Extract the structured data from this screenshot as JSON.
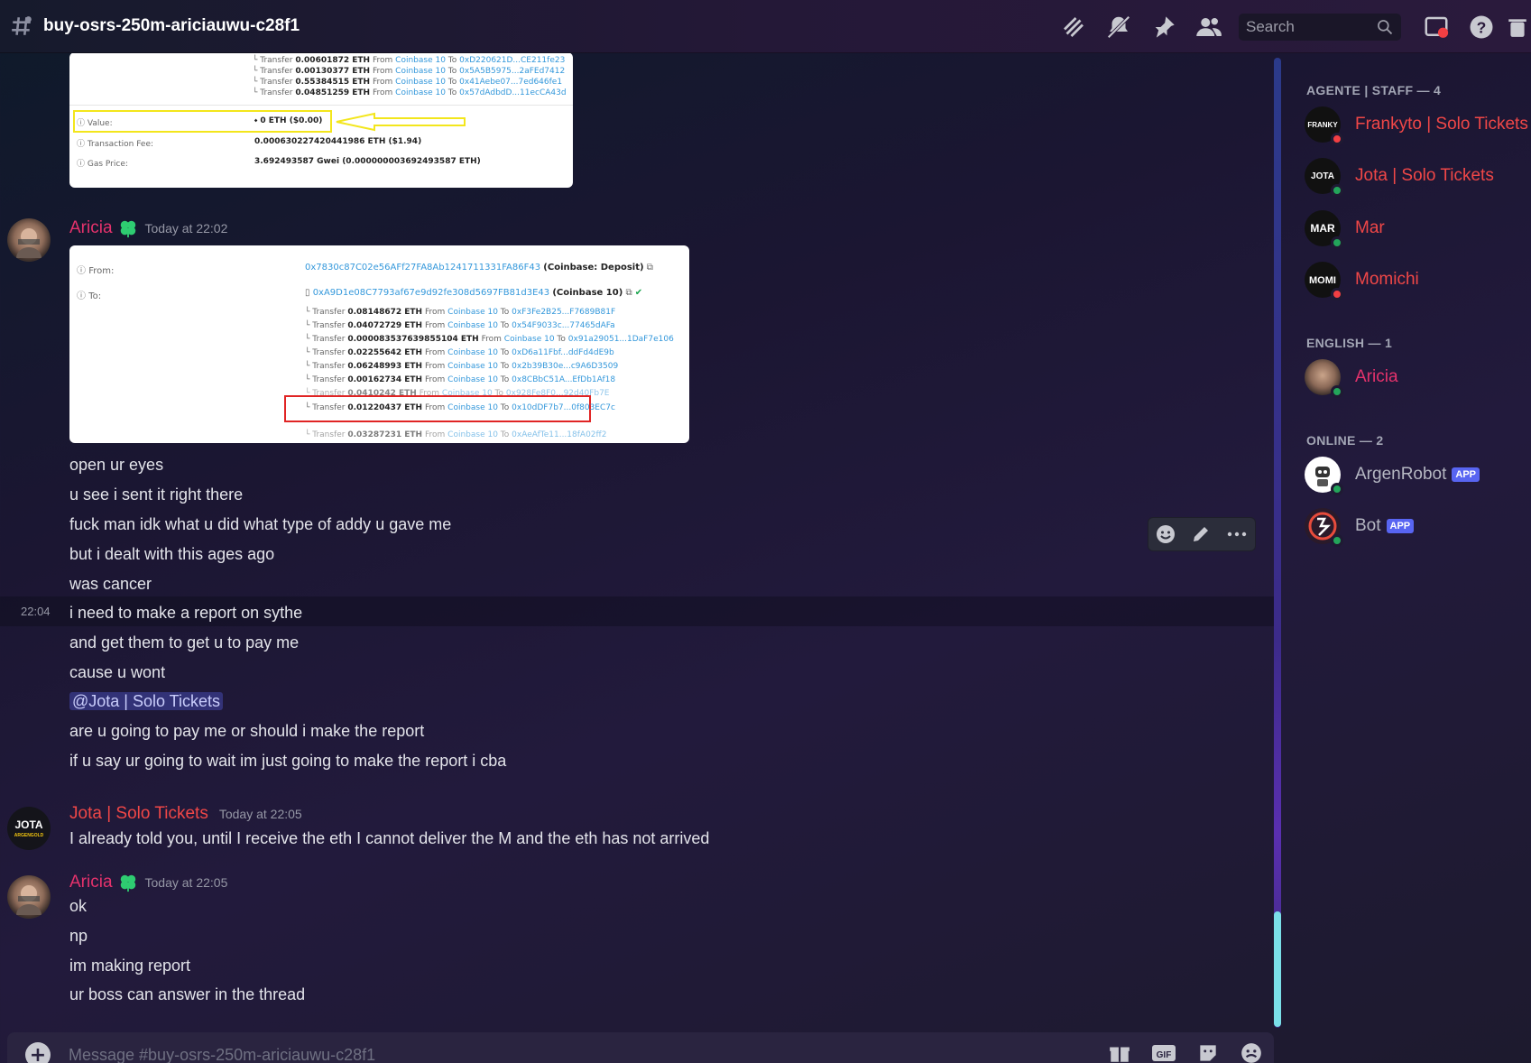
{
  "header": {
    "channel_name": "buy-osrs-250m-ariciauwu-c28f1",
    "search_placeholder": "Search"
  },
  "messages": {
    "embed1": {
      "transfers": [
        {
          "text": "Transfer",
          "amount": "0.00601872 ETH",
          "from_label": "From",
          "from": "Coinbase 10",
          "to_label": "To",
          "to": "0xD220621D...CE211fe23"
        },
        {
          "text": "Transfer",
          "amount": "0.00130377 ETH",
          "from_label": "From",
          "from": "Coinbase 10",
          "to_label": "To",
          "to": "0x5A5B5975...2aFEd7412"
        },
        {
          "text": "Transfer",
          "amount": "0.55384515 ETH",
          "from_label": "From",
          "from": "Coinbase 10",
          "to_label": "To",
          "to": "0x41Aebe07...7ed646fe1"
        },
        {
          "text": "Transfer",
          "amount": "0.04851259 ETH",
          "from_label": "From",
          "from": "Coinbase 10",
          "to_label": "To",
          "to": "0x57dAdbdD...11ecCA43d"
        }
      ],
      "value_label": "Value:",
      "value": "0 ETH ($0.00)",
      "fee_label": "Transaction Fee:",
      "fee": "0.000630227420441986 ETH ($1.94)",
      "gas_label": "Gas Price:",
      "gas": "3.692493587 Gwei (0.000000003692493587 ETH)"
    },
    "msg1": {
      "author": "Aricia",
      "timestamp": "Today at 22:02",
      "embed": {
        "from_label": "From:",
        "from_addr": "0x7830c87C02e56AFf27FA8Ab1241711331FA86F43",
        "from_tag": "(Coinbase: Deposit)",
        "to_label": "To:",
        "to_addr": "0xA9D1e08C7793af67e9d92fe308d5697FB81d3E43",
        "to_tag": "(Coinbase 10)",
        "transfers": [
          {
            "amount": "0.08148672 ETH",
            "to": "0xF3Fe2B25...F7689B81F"
          },
          {
            "amount": "0.04072729 ETH",
            "to": "0x54F9033c...77465dAFa"
          },
          {
            "amount": "0.000083537639855104 ETH",
            "to": "0x91a29051...1DaF7e106"
          },
          {
            "amount": "0.02255642 ETH",
            "to": "0xD6a11Fbf...ddFd4dE9b"
          },
          {
            "amount": "0.06248993 ETH",
            "to": "0x2b39B30e...c9A6D3509"
          },
          {
            "amount": "0.00162734 ETH",
            "to": "0x8CBbC51A...EfDb1Af18"
          },
          {
            "amount": "0.0410242 ETH",
            "to": "0x928Fe8F0...92d40Fb7E"
          },
          {
            "amount": "0.01220437 ETH",
            "to": "0x10dDF7b7...0f803EC7c"
          },
          {
            "amount": "0.03287231 ETH",
            "to": "0xAeAfTe11...18fA02ff2"
          }
        ],
        "transfer_word": "Transfer",
        "from_word": "From",
        "from_entity": "Coinbase 10",
        "to_word": "To"
      },
      "lines": [
        "open ur eyes",
        "u see i sent it right there",
        "fuck man idk what u did what type of addy u gave me",
        "but i dealt with this ages ago",
        "was cancer",
        "i need to make a report on sythe",
        "and get them to get u to pay me",
        "cause u wont",
        "@Jota | Solo Tickets",
        "are u going to pay me or should i make the report",
        "if u say ur going to wait im just going to make the report i cba"
      ],
      "hover_time": "22:04"
    },
    "msg2": {
      "author": "Jota | Solo Tickets",
      "timestamp": "Today at 22:05",
      "avatar_text": "JOTA",
      "avatar_sub": "ARGENGOLD",
      "text": "I already told you, until I receive the eth I cannot deliver the M and the eth has not arrived"
    },
    "msg3": {
      "author": "Aricia",
      "timestamp": "Today at 22:05",
      "lines": [
        "ok",
        "np",
        "im making report",
        "ur boss can answer in the thread"
      ]
    }
  },
  "composer": {
    "placeholder": "Message #buy-osrs-250m-ariciauwu-c28f1"
  },
  "members": {
    "groups": [
      {
        "title": "AGENTE | STAFF — 4"
      },
      {
        "title": "ENGLISH — 1"
      },
      {
        "title": "ONLINE — 2"
      }
    ],
    "list": [
      {
        "name": "Frankyto | Solo Tickets",
        "avatar_text": "FRANKY",
        "status": "dnd"
      },
      {
        "name": "Jota | Solo Tickets",
        "avatar_text": "JOTA",
        "status": "online"
      },
      {
        "name": "Mar",
        "avatar_text": "MAR",
        "status": "online"
      },
      {
        "name": "Momichi",
        "avatar_text": "MOMI",
        "status": "dnd"
      },
      {
        "name": "Aricia",
        "status": "online"
      },
      {
        "name": "ArgenRobot",
        "badge": "APP",
        "status": "online"
      },
      {
        "name": "Bot",
        "badge": "APP",
        "status": "online"
      }
    ]
  },
  "colors": {
    "staff_name": "#f04747",
    "aricia_name": "#e5326c",
    "online_name": "#b5b7c2",
    "link": "#3498db"
  }
}
